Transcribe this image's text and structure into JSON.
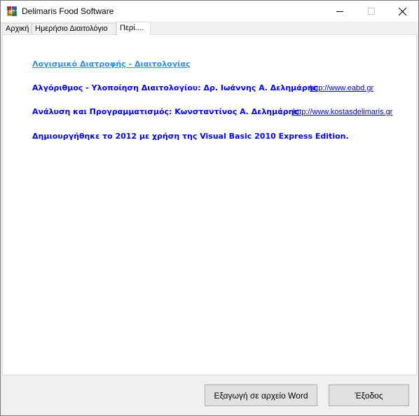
{
  "window": {
    "title": "Delimaris Food Software",
    "icon": "app-icon",
    "controls": [
      "minimize-icon",
      "maximize-icon",
      "close-icon"
    ]
  },
  "tabs": [
    {
      "label": "Αρχική",
      "selected": false
    },
    {
      "label": "Ημερήσιο Διαιτολόγιο",
      "selected": false
    },
    {
      "label": "Περί....",
      "selected": true
    }
  ],
  "about": {
    "heading_link": "Λογισμικό Διατροφής - Διαιτολογίας",
    "line1": "Αλγόριθμος - Υλοποίηση Διαιτολογίου: Δρ. Ιωάννης Α. Δελημάρης",
    "url1": "http://www.eabd.gr",
    "line2": "Ανάλυση και Προγραμματισμός: Κωνσταντίνος Α. Δελημάρης",
    "url2": "http://www.kostasdelimaris.gr",
    "line3": "Δημιουργήθηκε το 2012 με χρήση της Visual Basic 2010 Express Edition."
  },
  "footer": {
    "export_label": "Εξαγωγή σε αρχείο Word",
    "exit_label": "Έξοδος"
  },
  "colors": {
    "text_blue": "#0000ff",
    "heading_link": "#1e90ff",
    "url_link": "#0000cc"
  }
}
